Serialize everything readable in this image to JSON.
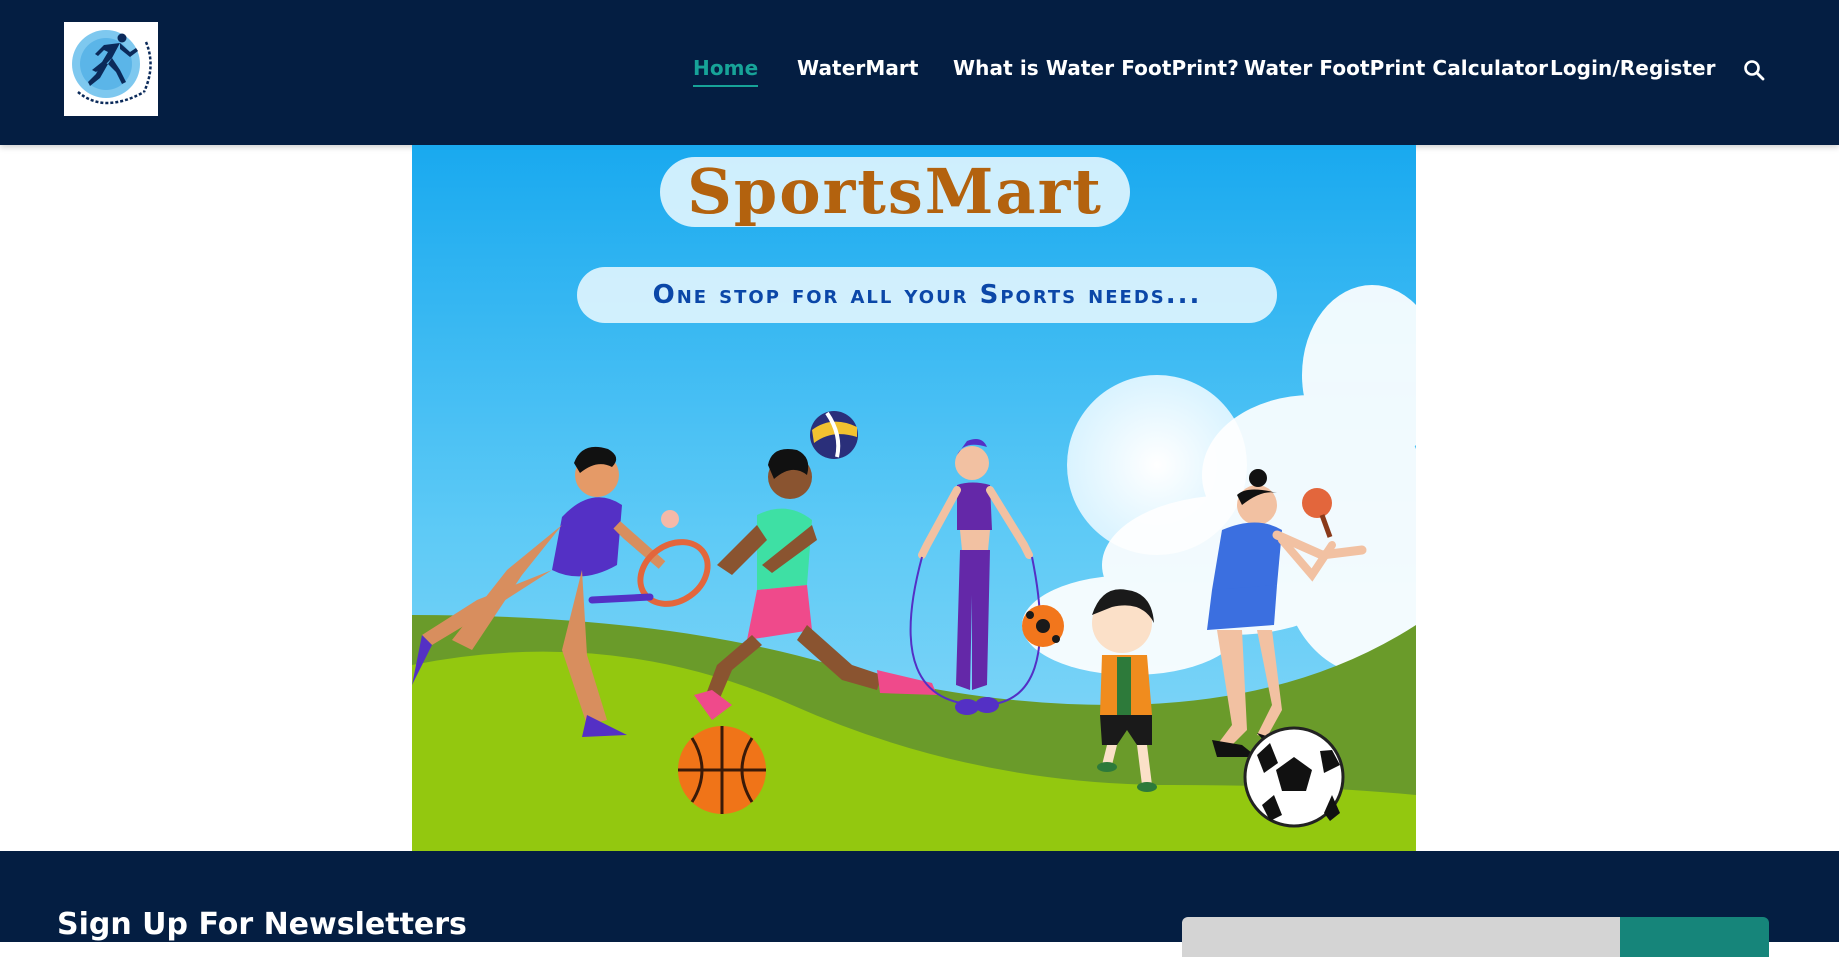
{
  "brand": {
    "logo_alt": "SportsMart logo",
    "logo_arc_text": "One stop for all your Sports needs",
    "logo_top_text": "SportsMart"
  },
  "nav": {
    "items": [
      {
        "label": "Home",
        "active": true
      },
      {
        "label": "WaterMart",
        "active": false
      },
      {
        "label": "What is Water FootPrint?",
        "active": false
      },
      {
        "label": "Water FootPrint Calculator",
        "active": false
      },
      {
        "label": "Login/Register",
        "active": false
      }
    ],
    "search_icon": "search-icon"
  },
  "hero": {
    "title": "SportsMart",
    "tagline": "One stop for all your Sports needs..."
  },
  "newsletter": {
    "title": "Sign Up For Newsletters",
    "input_placeholder": "",
    "button_label": ""
  },
  "colors": {
    "header_bg": "#041e42",
    "accent": "#17a398",
    "title_color": "#b3620e",
    "tagline_color": "#0b47a8"
  }
}
